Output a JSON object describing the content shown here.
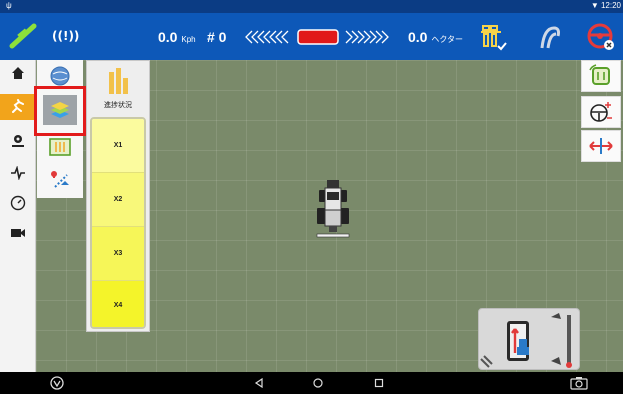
{
  "statusbar": {
    "time": "12:20"
  },
  "topbar": {
    "signal_label": "((!))",
    "speed_value": "0.0",
    "speed_unit": "Kph",
    "row_number": "# 0",
    "area_value": "0.0",
    "area_unit": "ヘクター"
  },
  "sidebar": {
    "items": [
      {
        "icon": "home-icon"
      },
      {
        "icon": "tractor-run-icon",
        "active": true
      },
      {
        "icon": "settings-icon"
      },
      {
        "icon": "pulse-icon"
      },
      {
        "icon": "gauge-icon"
      },
      {
        "icon": "camera-icon"
      }
    ]
  },
  "layer_column": {
    "buttons": [
      {
        "icon": "globe-icon"
      },
      {
        "icon": "layers-icon",
        "selected": true
      },
      {
        "icon": "field-icon"
      },
      {
        "icon": "route-icon"
      }
    ]
  },
  "progress_panel": {
    "title": "進捗状況",
    "rows": [
      "X1",
      "X2",
      "X3",
      "X4"
    ]
  },
  "colors": {
    "topbar": "#0d58b8",
    "statusbar": "#0b3c84",
    "active_sidebar": "#f2a41b",
    "highlight": "#e21b1b",
    "map": "#7a8a6a"
  }
}
